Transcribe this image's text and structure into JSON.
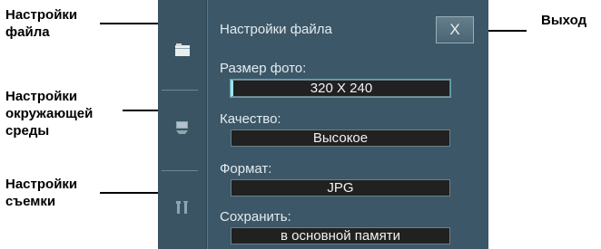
{
  "callouts": {
    "file_settings": [
      "Настройки",
      "файла"
    ],
    "environment_settings": [
      "Настройки",
      "окружающей",
      "среды"
    ],
    "shooting_settings": [
      "Настройки",
      "съемки"
    ],
    "exit": "Выход"
  },
  "sidebar": {
    "items": [
      {
        "icon": "folder-icon",
        "active": true
      },
      {
        "icon": "display-settings-icon",
        "active": false
      },
      {
        "icon": "tools-icon",
        "active": false
      }
    ]
  },
  "panel": {
    "title": "Настройки файла",
    "close_label": "X",
    "fields": [
      {
        "label": "Размер фото:",
        "value": "320 X 240",
        "selected": true
      },
      {
        "label": "Качество:",
        "value": "Высокое",
        "selected": false
      },
      {
        "label": "Формат:",
        "value": "JPG",
        "selected": false
      },
      {
        "label": "Сохранить:",
        "value": "в основной памяти",
        "selected": false
      }
    ]
  },
  "colors": {
    "screen_bg": "#3c5767",
    "field_bg": "#212121",
    "selection_accent": "#9fe3ee",
    "text": "#e3ecf0"
  }
}
